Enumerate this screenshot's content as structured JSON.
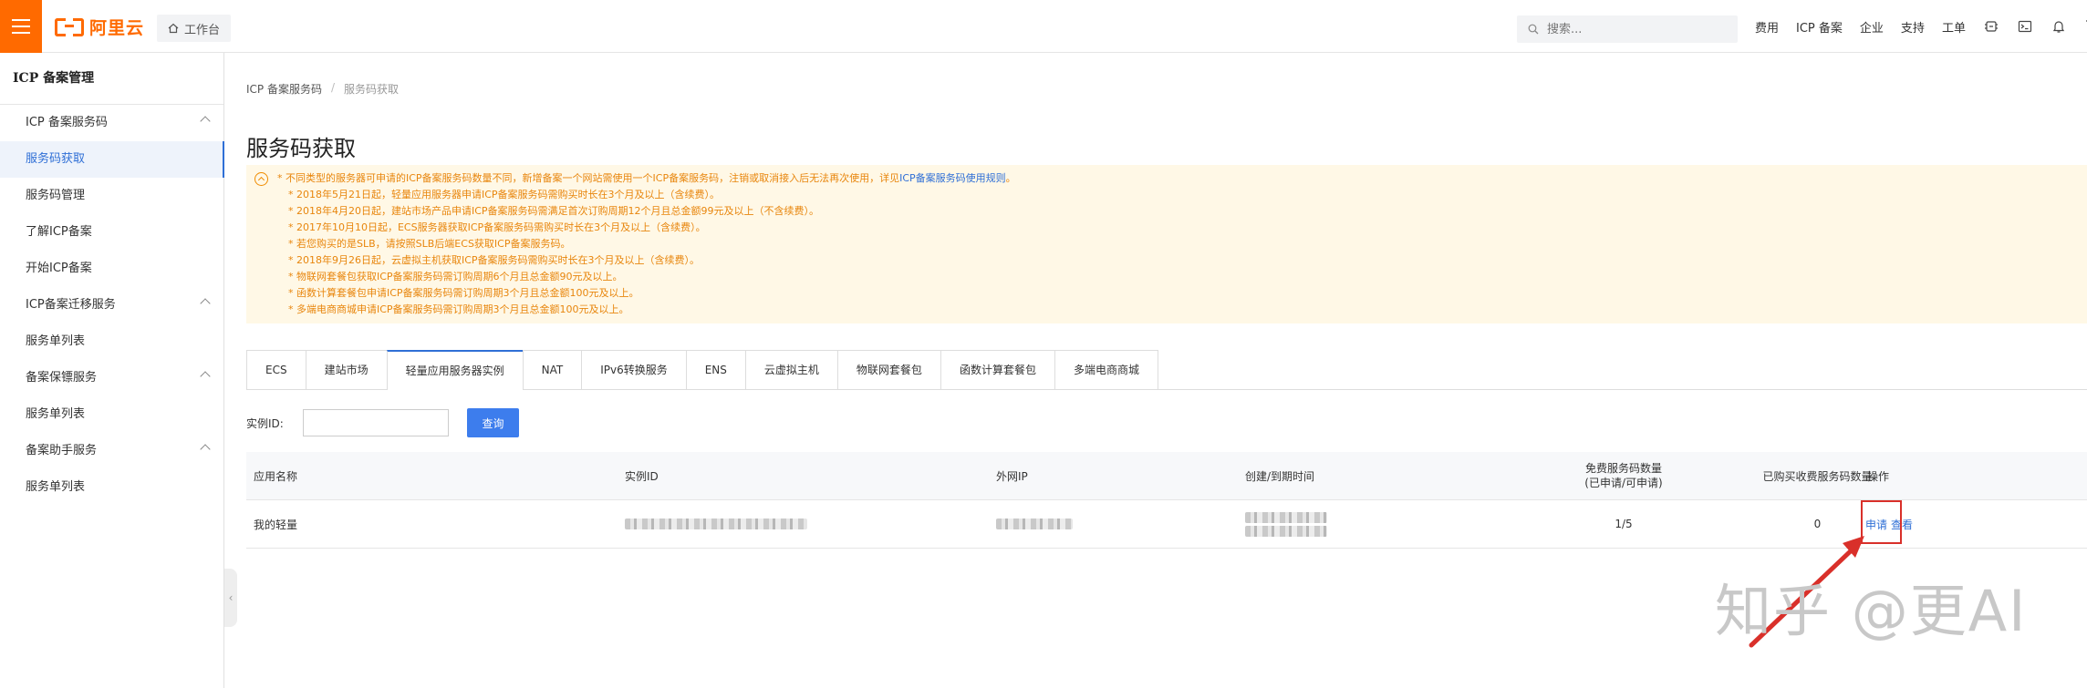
{
  "topbar": {
    "logo_text": "阿里云",
    "workbench": "工作台",
    "search_placeholder": "搜索...",
    "links": [
      "费用",
      "ICP 备案",
      "企业",
      "支持",
      "工单"
    ]
  },
  "sidebar": {
    "title": "ICP 备案管理",
    "items": [
      {
        "label": "ICP 备案服务码"
      },
      {
        "label": "服务码获取"
      },
      {
        "label": "服务码管理"
      },
      {
        "label": "了解ICP备案"
      },
      {
        "label": "开始ICP备案"
      },
      {
        "label": "ICP备案迁移服务"
      },
      {
        "label": "服务单列表"
      },
      {
        "label": "备案保镖服务"
      },
      {
        "label": "服务单列表"
      },
      {
        "label": "备案助手服务"
      },
      {
        "label": "服务单列表"
      }
    ]
  },
  "breadcrumb": {
    "root": "ICP 备案服务码",
    "sep": "/",
    "current": "服务码获取"
  },
  "page_title": "服务码获取",
  "notice": {
    "line0_pre": "* 不同类型的服务器可申请的ICP备案服务码数量不同，新增备案一个网站需使用一个ICP备案服务码，注销或取消接入后无法再次使用，详见",
    "line0_link": "ICP备案服务码使用规则",
    "line0_post": "。",
    "lines": [
      "* 2018年5月21日起，轻量应用服务器申请ICP备案服务码需购买时长在3个月及以上（含续费）。",
      "* 2018年4月20日起，建站市场产品申请ICP备案服务码需满足首次订购周期12个月且总金额99元及以上（不含续费）。",
      "* 2017年10月10日起，ECS服务器获取ICP备案服务码需购买时长在3个月及以上（含续费）。",
      "* 若您购买的是SLB，请按照SLB后端ECS获取ICP备案服务码。",
      "* 2018年9月26日起，云虚拟主机获取ICP备案服务码需购买时长在3个月及以上（含续费）。",
      "* 物联网套餐包获取ICP备案服务码需订购周期6个月且总金额90元及以上。",
      "* 函数计算套餐包申请ICP备案服务码需订购周期3个月且总金额100元及以上。",
      "* 多端电商商城申请ICP备案服务码需订购周期3个月且总金额100元及以上。"
    ]
  },
  "tabs": [
    "ECS",
    "建站市场",
    "轻量应用服务器实例",
    "NAT",
    "IPv6转换服务",
    "ENS",
    "云虚拟主机",
    "物联网套餐包",
    "函数计算套餐包",
    "多端电商商城"
  ],
  "active_tab": "轻量应用服务器实例",
  "filter": {
    "label": "实例ID:",
    "placeholder": "",
    "button": "查询"
  },
  "table": {
    "headers": {
      "app_name": "应用名称",
      "instance_id": "实例ID",
      "public_ip": "外网IP",
      "time": "创建/到期时间",
      "free_line1": "免费服务码数量",
      "free_line2": "(已申请/可申请)",
      "paid": "已购买收费服务码数量",
      "op": "操作"
    },
    "rows": [
      {
        "app_name": "我的轻量",
        "free": "1/5",
        "paid": "0",
        "apply": "申请",
        "view": "查看"
      }
    ]
  },
  "watermark": "知乎 @更AI",
  "colors": {
    "brand": "#ff6a00",
    "link": "#2f6fd6",
    "notice_text": "#e8860d",
    "notice_bg": "#fff8e6",
    "annotation": "#d9302a"
  }
}
